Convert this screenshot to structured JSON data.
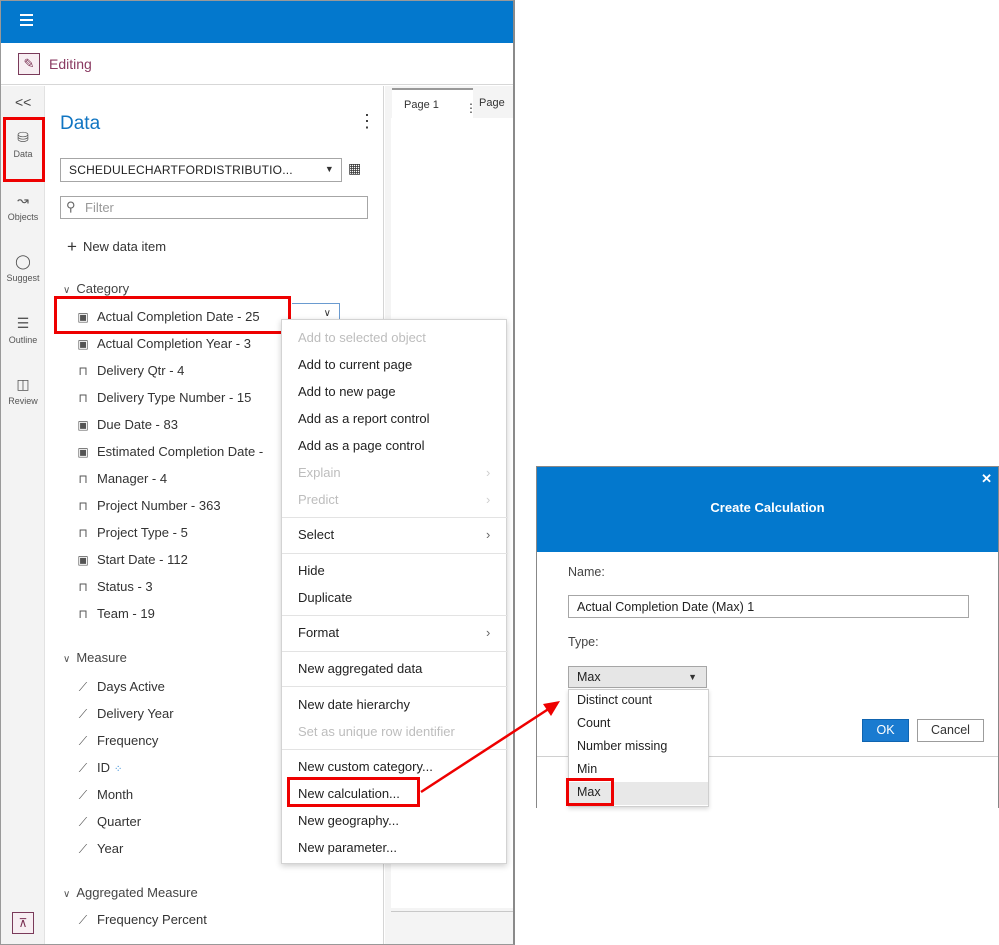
{
  "mode": {
    "label": "Editing"
  },
  "rail": {
    "collapse_glyph": "<<",
    "items": [
      {
        "label": "Data",
        "icon": "database-icon"
      },
      {
        "label": "Objects",
        "icon": "line-chart-icon"
      },
      {
        "label": "Suggest",
        "icon": "lightbulb-icon"
      },
      {
        "label": "Outline",
        "icon": "list-icon"
      },
      {
        "label": "Review",
        "icon": "review-icon"
      }
    ]
  },
  "data_pane": {
    "title": "Data",
    "source": "SCHEDULECHARTFORDISTRIBUTIO...",
    "filter_placeholder": "Filter",
    "new_item_label": "New data item",
    "groups": {
      "category": "Category",
      "measure": "Measure",
      "aggregated": "Aggregated Measure"
    },
    "category_items": [
      {
        "label": "Actual Completion Date - 25",
        "icon": "calendar-icon"
      },
      {
        "label": "Actual Completion Year - 3",
        "icon": "calendar-icon"
      },
      {
        "label": "Delivery Qtr - 4",
        "icon": "category-icon"
      },
      {
        "label": "Delivery Type Number - 15",
        "icon": "category-icon"
      },
      {
        "label": "Due Date - 83",
        "icon": "calendar-icon"
      },
      {
        "label": "Estimated Completion Date -",
        "icon": "calendar-icon"
      },
      {
        "label": "Manager - 4",
        "icon": "category-icon"
      },
      {
        "label": "Project Number - 363",
        "icon": "category-icon"
      },
      {
        "label": "Project Type - 5",
        "icon": "category-icon"
      },
      {
        "label": "Start Date - 112",
        "icon": "calendar-icon"
      },
      {
        "label": "Status - 3",
        "icon": "category-icon"
      },
      {
        "label": "Team - 19",
        "icon": "category-icon"
      }
    ],
    "measure_items": [
      {
        "label": "Days Active",
        "icon": "ruler-icon"
      },
      {
        "label": "Delivery Year",
        "icon": "ruler-icon"
      },
      {
        "label": "Frequency",
        "icon": "ruler-icon"
      },
      {
        "label": "ID",
        "icon": "ruler-icon"
      },
      {
        "label": "Month",
        "icon": "ruler-icon"
      },
      {
        "label": "Quarter",
        "icon": "ruler-icon"
      },
      {
        "label": "Year",
        "icon": "ruler-icon"
      }
    ],
    "aggregated_items": [
      {
        "label": "Frequency Percent",
        "icon": "ruler-icon"
      }
    ]
  },
  "canvas": {
    "tabs": [
      "Page 1",
      "Page"
    ]
  },
  "context_menu": {
    "items": [
      {
        "label": "Add to selected object",
        "disabled": true
      },
      {
        "label": "Add to current page",
        "disabled": false
      },
      {
        "label": "Add to new page",
        "disabled": false
      },
      {
        "label": "Add as a report control",
        "disabled": false
      },
      {
        "label": "Add as a page control",
        "disabled": false
      },
      {
        "label": "Explain",
        "disabled": true
      },
      {
        "label": "Predict",
        "disabled": true
      },
      {
        "label": "Select",
        "disabled": false
      },
      {
        "label": "Hide",
        "disabled": false
      },
      {
        "label": "Duplicate",
        "disabled": false
      },
      {
        "label": "Format",
        "disabled": false
      },
      {
        "label": "New aggregated data",
        "disabled": false
      },
      {
        "label": "New date hierarchy",
        "disabled": false
      },
      {
        "label": "Set as unique row identifier",
        "disabled": true
      },
      {
        "label": "New custom category...",
        "disabled": false
      },
      {
        "label": "New calculation...",
        "disabled": false
      },
      {
        "label": "New geography...",
        "disabled": false
      },
      {
        "label": "New parameter...",
        "disabled": false
      }
    ]
  },
  "dialog": {
    "title": "Create Calculation",
    "name_label": "Name:",
    "name_value": "Actual Completion Date (Max) 1",
    "type_label": "Type:",
    "type_value": "Max",
    "options": [
      "Distinct count",
      "Count",
      "Number missing",
      "Min",
      "Max"
    ],
    "ok_label": "OK",
    "cancel_label": "Cancel"
  },
  "colors": {
    "header_blue": "#0378cd",
    "highlight_red": "#e00000",
    "title_blue": "#1075c2",
    "edit_magenta": "#8a3a62"
  }
}
